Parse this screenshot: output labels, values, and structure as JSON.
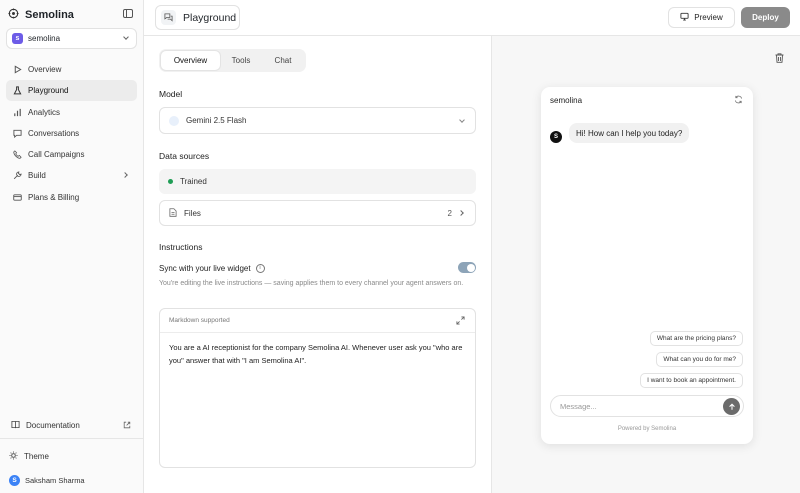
{
  "brand": {
    "name": "Semolina"
  },
  "workspace": {
    "name": "semolina",
    "initial": "s"
  },
  "sidebar": {
    "items": [
      {
        "label": "Overview"
      },
      {
        "label": "Playground"
      },
      {
        "label": "Analytics"
      },
      {
        "label": "Conversations"
      },
      {
        "label": "Call Campaigns"
      },
      {
        "label": "Build"
      },
      {
        "label": "Plans & Billing"
      }
    ],
    "documentation": "Documentation",
    "theme": "Theme",
    "user": {
      "name": "Saksham Sharma",
      "initial": "S"
    }
  },
  "header": {
    "title": "Playground",
    "preview_label": "Preview",
    "deploy_label": "Deploy"
  },
  "tabs": [
    {
      "label": "Overview"
    },
    {
      "label": "Tools"
    },
    {
      "label": "Chat"
    }
  ],
  "model": {
    "label": "Model",
    "selected": "Gemini 2.5 Flash"
  },
  "data_sources": {
    "label": "Data sources",
    "status": "Trained",
    "files_label": "Files",
    "files_count": "2"
  },
  "instructions": {
    "label": "Instructions",
    "sync_label": "Sync with your live widget",
    "sync_enabled": true,
    "helper": "You're editing the live instructions — saving applies them to every channel your agent answers on.",
    "editor_hint": "Markdown supported",
    "text": "You are a AI receptionist for the company Semolina AI. Whenever user ask you \"who are you\" answer that with \"I am Semolina AI\"."
  },
  "chat": {
    "title": "semolina",
    "bot_initial": "S",
    "greeting": "Hi! How can I help you today?",
    "suggestions": [
      "What are the pricing plans?",
      "What can you do for me?",
      "I want to book an appointment."
    ],
    "input_placeholder": "Message...",
    "powered_by": "Powered by Semolina"
  },
  "colors": {
    "accent": "#6d5ce7",
    "deploy_bg": "#8a8a8a",
    "status_green": "#1f9d55",
    "toggle_on": "#8da4b8"
  }
}
